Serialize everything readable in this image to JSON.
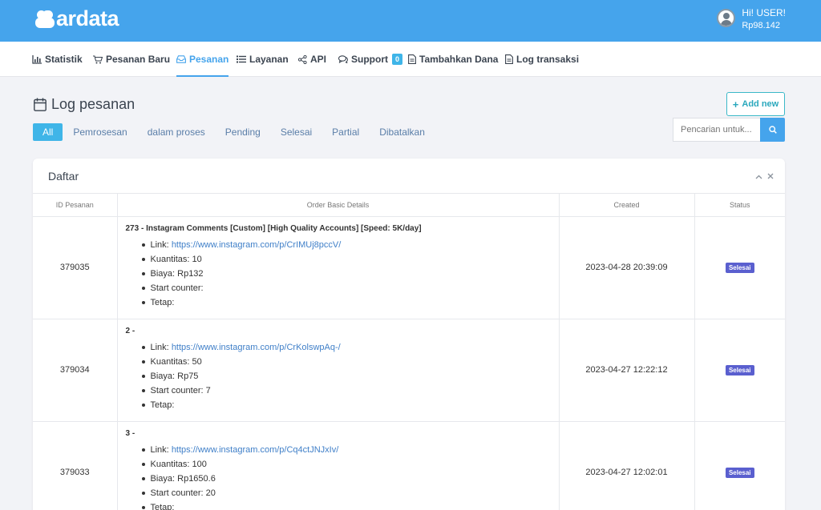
{
  "header": {
    "logo_text": "ardata",
    "greeting": "Hi! USER!",
    "balance": "Rp98.142"
  },
  "nav": {
    "items": [
      {
        "label": "Statistik",
        "icon": "bar-chart-icon"
      },
      {
        "label": "Pesanan Baru",
        "icon": "cart-icon"
      },
      {
        "label": "Pesanan",
        "icon": "inbox-icon",
        "active": true
      },
      {
        "label": "Layanan",
        "icon": "list-icon"
      },
      {
        "label": "API",
        "icon": "share-icon"
      },
      {
        "label": "Support",
        "icon": "chat-icon",
        "badge": "0"
      },
      {
        "label": "Tambahkan Dana",
        "icon": "document-icon"
      },
      {
        "label": "Log transaksi",
        "icon": "document-icon"
      }
    ]
  },
  "page": {
    "title": "Log pesanan",
    "add_new_label": "Add new",
    "filters": [
      "All",
      "Pemrosesan",
      "dalam proses",
      "Pending",
      "Selesai",
      "Partial",
      "Dibatalkan"
    ],
    "search_placeholder": "Pencarian untuk..."
  },
  "card": {
    "title": "Daftar",
    "columns": [
      "ID Pesanan",
      "Order Basic Details",
      "Created",
      "Status"
    ],
    "rows": [
      {
        "id": "379035",
        "title": "273 - Instagram Comments [Custom] [High Quality Accounts] [Speed: 5K/day]",
        "link_label": "Link:",
        "link": "https://www.instagram.com/p/CrIMUj8pccV/",
        "quantity": "Kuantitas: 10",
        "cost": "Biaya: Rp132",
        "start_counter": "Start counter:",
        "remains": "Tetap:",
        "created": "2023-04-28 20:39:09",
        "status": "Selesai"
      },
      {
        "id": "379034",
        "title": "2 -",
        "link_label": "Link:",
        "link": "https://www.instagram.com/p/CrKolswpAq-/",
        "quantity": "Kuantitas: 50",
        "cost": "Biaya: Rp75",
        "start_counter": "Start counter: 7",
        "remains": "Tetap:",
        "created": "2023-04-27 12:22:12",
        "status": "Selesai"
      },
      {
        "id": "379033",
        "title": "3 -",
        "link_label": "Link:",
        "link": "https://www.instagram.com/p/Cq4ctJNJxIv/",
        "quantity": "Kuantitas: 100",
        "cost": "Biaya: Rp1650.6",
        "start_counter": "Start counter: 20",
        "remains": "Tetap:",
        "created": "2023-04-27 12:02:01",
        "status": "Selesai"
      }
    ]
  },
  "colors": {
    "primary": "#45a4ec",
    "badge_status": "#5a5fcf",
    "accent": "#3fb5e8"
  }
}
